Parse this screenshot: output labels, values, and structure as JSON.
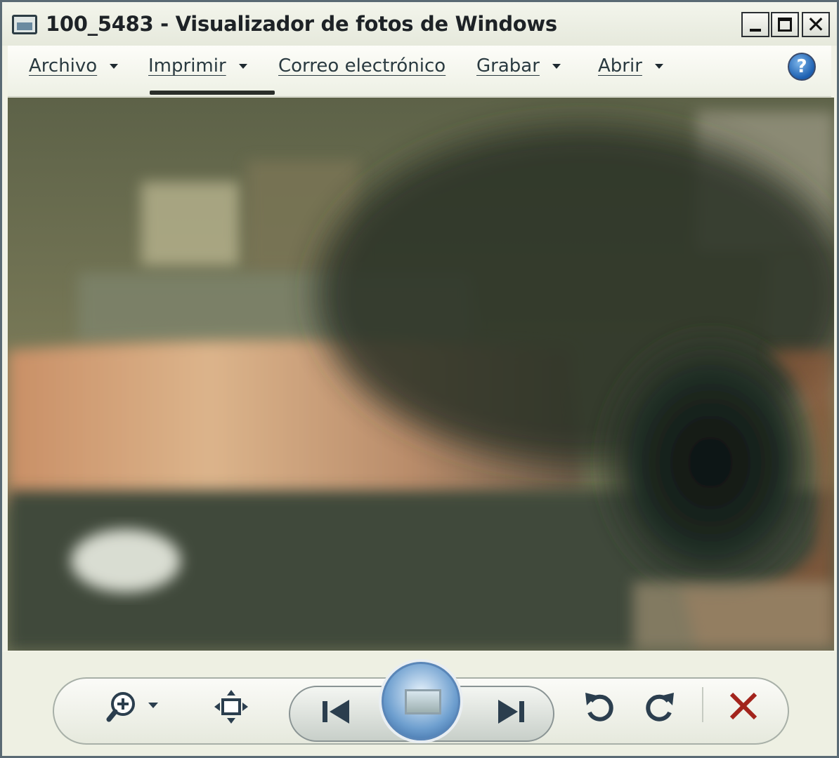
{
  "window": {
    "title": "100_5483 - Visualizador de fotos de Windows"
  },
  "menu": {
    "items": [
      {
        "label": "Archivo",
        "has_dropdown": true
      },
      {
        "label": "Imprimir",
        "has_dropdown": true
      },
      {
        "label": "Correo electrónico",
        "has_dropdown": false
      },
      {
        "label": "Grabar",
        "has_dropdown": true
      },
      {
        "label": "Abrir",
        "has_dropdown": true
      }
    ],
    "help_icon": "help-icon",
    "help_glyph": "?"
  },
  "window_buttons": {
    "minimize_icon": "minimize-icon",
    "maximize_icon": "maximize-icon",
    "close_icon": "close-icon",
    "close_glyph": "✕"
  },
  "toolbar": {
    "buttons": [
      {
        "icon": "zoom-icon",
        "has_dropdown": true
      },
      {
        "icon": "fit-window-icon"
      },
      {
        "icon": "previous-icon"
      },
      {
        "icon": "slideshow-icon"
      },
      {
        "icon": "next-icon"
      },
      {
        "icon": "rotate-counterclockwise-icon"
      },
      {
        "icon": "rotate-clockwise-icon"
      },
      {
        "icon": "delete-icon"
      }
    ],
    "delete_color": "#a3241c",
    "slideshow_color": "#3b6fb0"
  }
}
